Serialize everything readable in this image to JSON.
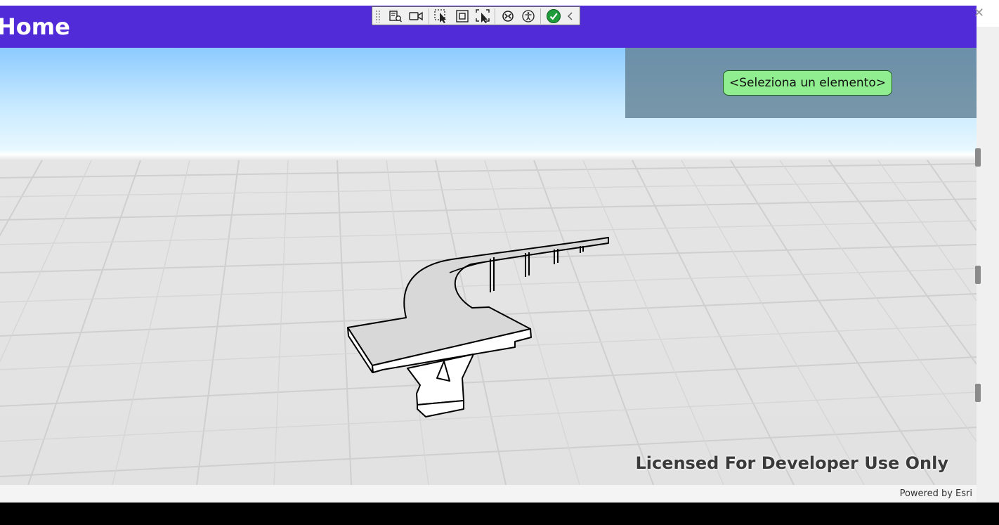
{
  "window": {
    "title": "Home"
  },
  "debug_toolbar": {
    "buttons": [
      "live-visual-tree-icon",
      "camera-icon",
      "select-element-icon",
      "display-layout-adorners-icon",
      "track-focused-element-icon",
      "hot-reload-icon",
      "accessibility-icon",
      "checkmark-icon",
      "collapse-chevron-icon"
    ],
    "colors": {
      "bar": "#f0f0f0",
      "check": "#1e9c3a"
    }
  },
  "map": {
    "feature_selector_label": "<Seleziona un elemento>",
    "watermark": "Licensed For Developer Use Only",
    "attribution": "Powered by Esri",
    "colors": {
      "header": "#522bd8",
      "panel": "#6482a0",
      "selector_bg": "#90ee90",
      "ground": "#e2e2e2",
      "sky": "#8ccbff"
    }
  }
}
